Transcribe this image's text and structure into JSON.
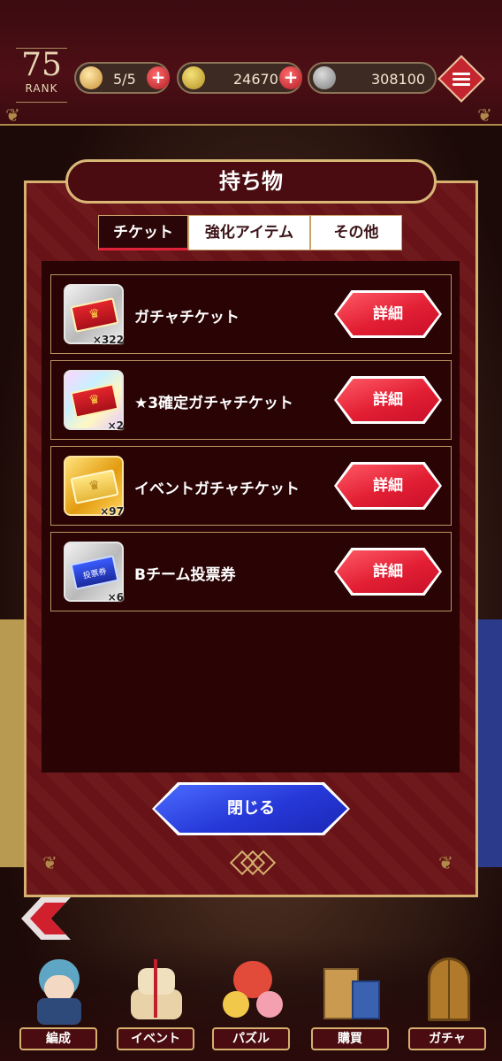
{
  "header": {
    "rank_value": "75",
    "rank_label": "RANK",
    "stamina": "5/5",
    "coins": "24670",
    "silver": "308100"
  },
  "modal": {
    "title": "持ち物",
    "tabs": [
      {
        "label": "チケット",
        "active": true
      },
      {
        "label": "強化アイテム",
        "active": false
      },
      {
        "label": "その他",
        "active": false
      }
    ],
    "items": [
      {
        "name": "ガチャチケット",
        "count": "×322",
        "icon": "red-ticket-icon",
        "button": "詳細"
      },
      {
        "name": "★3確定ガチャチケット",
        "count": "×2",
        "icon": "rainbow-red-ticket-icon",
        "button": "詳細"
      },
      {
        "name": "イベントガチャチケット",
        "count": "×97",
        "icon": "gold-ticket-icon",
        "button": "詳細"
      },
      {
        "name": "Bチーム投票券",
        "count": "×6",
        "icon": "vote-ticket-icon",
        "ticket_text": "投票券",
        "button": "詳細"
      }
    ],
    "close_label": "閉じる"
  },
  "nav": [
    {
      "label": "編成",
      "icon": "character-icon"
    },
    {
      "label": "イベント",
      "icon": "cake-icon"
    },
    {
      "label": "パズル",
      "icon": "puzzle-characters-icon"
    },
    {
      "label": "購買",
      "icon": "shopping-bag-icon"
    },
    {
      "label": "ガチャ",
      "icon": "door-icon"
    }
  ],
  "colors": {
    "modal_bg": "#6b1418",
    "list_bg": "#2a0405",
    "gold_border": "#d5b06e",
    "detail_button": "#e21e33",
    "close_button": "#2638d8"
  }
}
